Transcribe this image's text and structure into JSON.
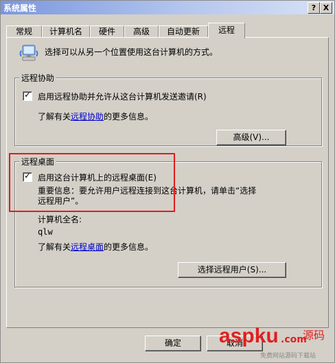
{
  "window": {
    "title": "系统属性",
    "help_btn": "?",
    "close_btn": "X"
  },
  "tabs": [
    "常规",
    "计算机名",
    "硬件",
    "高级",
    "自动更新",
    "远程"
  ],
  "intro": "选择可以从另一个位置使用这台计算机的方式。",
  "remote_assist": {
    "legend": "远程协助",
    "checkbox_label": "启用远程协助并允许从这台计算机发送邀请(R)",
    "learn_prefix": "了解有关",
    "learn_link": "远程协助",
    "learn_suffix": "的更多信息。",
    "advanced_btn": "高级(V)..."
  },
  "remote_desktop": {
    "legend": "远程桌面",
    "checkbox_label": "启用这台计算机上的远程桌面(E)",
    "important_line1": "重要信息：要允许用户远程连接到这台计算机，请单击“选择",
    "important_line2": "远程用户”。",
    "fullname_label": "计算机全名:",
    "fullname_value": "qlw",
    "learn_prefix": "了解有关",
    "learn_link": "远程桌面",
    "learn_suffix": "的更多信息。",
    "select_users_btn": "选择远程用户(S)..."
  },
  "footer": {
    "ok_btn": "确定",
    "cancel_btn": "取消"
  },
  "watermark": {
    "brand": "aspku",
    "suffix": ".com",
    "cn": "源码",
    "sub": "免费网站源码下载站"
  }
}
